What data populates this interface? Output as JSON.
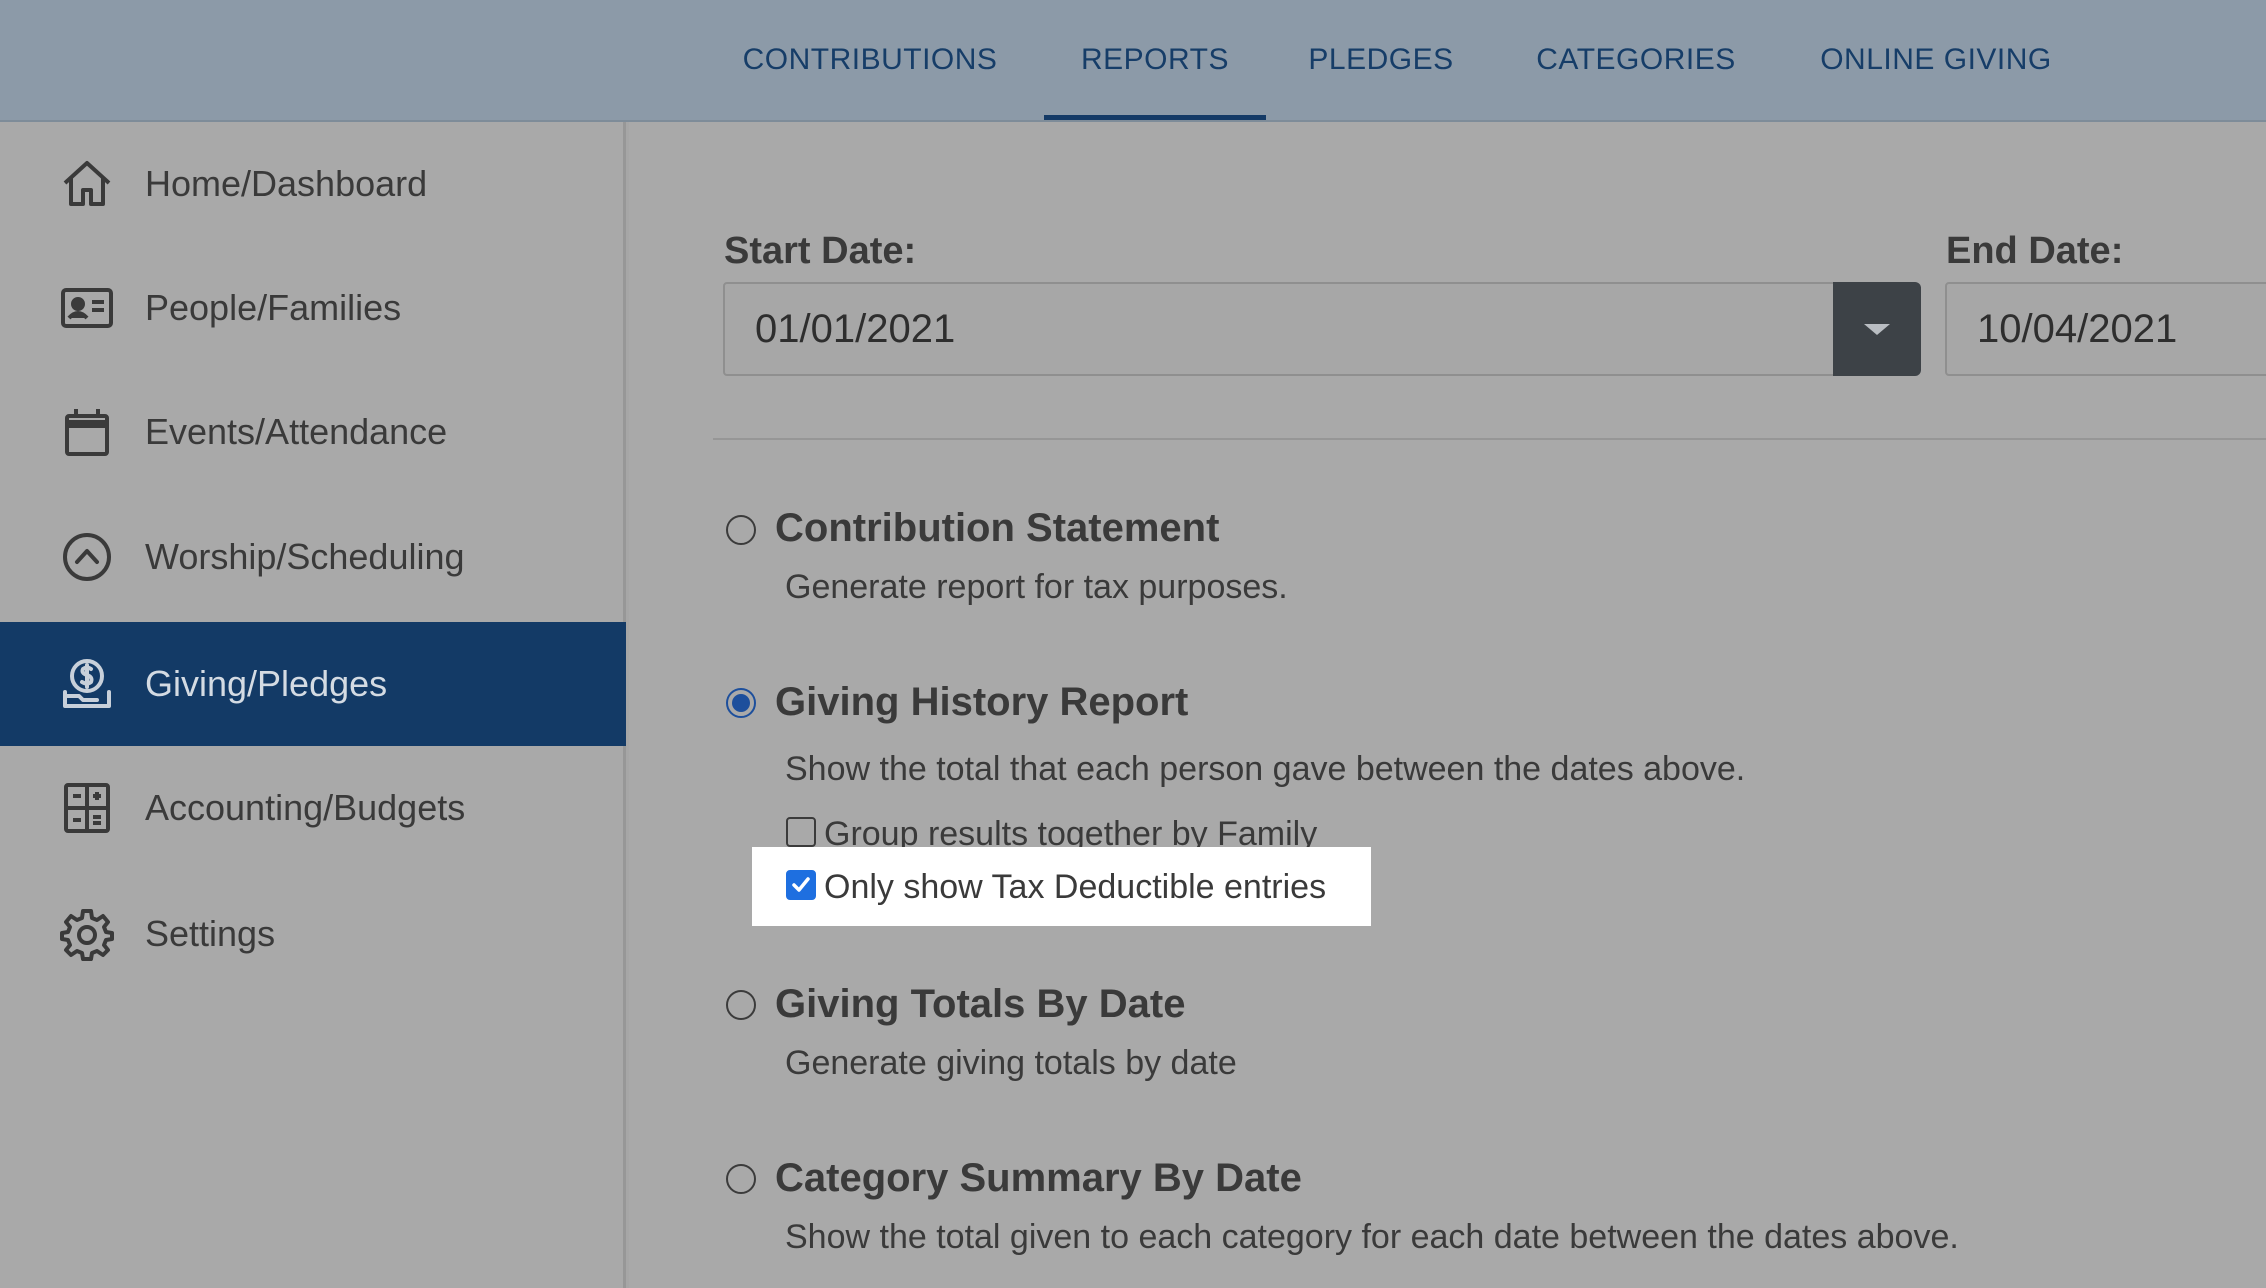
{
  "tabs": [
    {
      "label": "CONTRIBUTIONS",
      "active": false
    },
    {
      "label": "REPORTS",
      "active": true
    },
    {
      "label": "PLEDGES",
      "active": false
    },
    {
      "label": "CATEGORIES",
      "active": false
    },
    {
      "label": "ONLINE GIVING",
      "active": false
    }
  ],
  "sidebar": {
    "items": [
      {
        "label": "Home/Dashboard",
        "icon": "home-icon"
      },
      {
        "label": "People/Families",
        "icon": "contact-card-icon"
      },
      {
        "label": "Events/Attendance",
        "icon": "calendar-icon"
      },
      {
        "label": "Worship/Scheduling",
        "icon": "chevron-up-circle-icon"
      },
      {
        "label": "Giving/Pledges",
        "icon": "giving-hand-dollar-icon",
        "active": true
      },
      {
        "label": "Accounting/Budgets",
        "icon": "ledger-grid-icon"
      },
      {
        "label": "Settings",
        "icon": "gear-icon"
      }
    ]
  },
  "filters": {
    "start_label": "Start Date:",
    "start_value": "01/01/2021",
    "end_label": "End Date:",
    "end_value": "10/04/2021"
  },
  "reports": [
    {
      "title": "Contribution Statement",
      "desc": "Generate report for tax purposes.",
      "selected": false
    },
    {
      "title": "Giving History Report",
      "desc": "Show the total that each person gave between the dates above.",
      "selected": true
    },
    {
      "title": "Giving Totals By Date",
      "desc": "Generate giving totals by date",
      "selected": false
    },
    {
      "title": "Category Summary By Date",
      "desc": "Show the total given to each category for each date between the dates above.",
      "selected": false
    }
  ],
  "options": {
    "group_family": {
      "label": "Group results together by Family",
      "checked": false
    },
    "tax_deductible": {
      "label": "Only show Tax Deductible entries",
      "checked": true
    }
  },
  "colors": {
    "accent": "#133a66",
    "checkbox": "#1e6fe0"
  }
}
